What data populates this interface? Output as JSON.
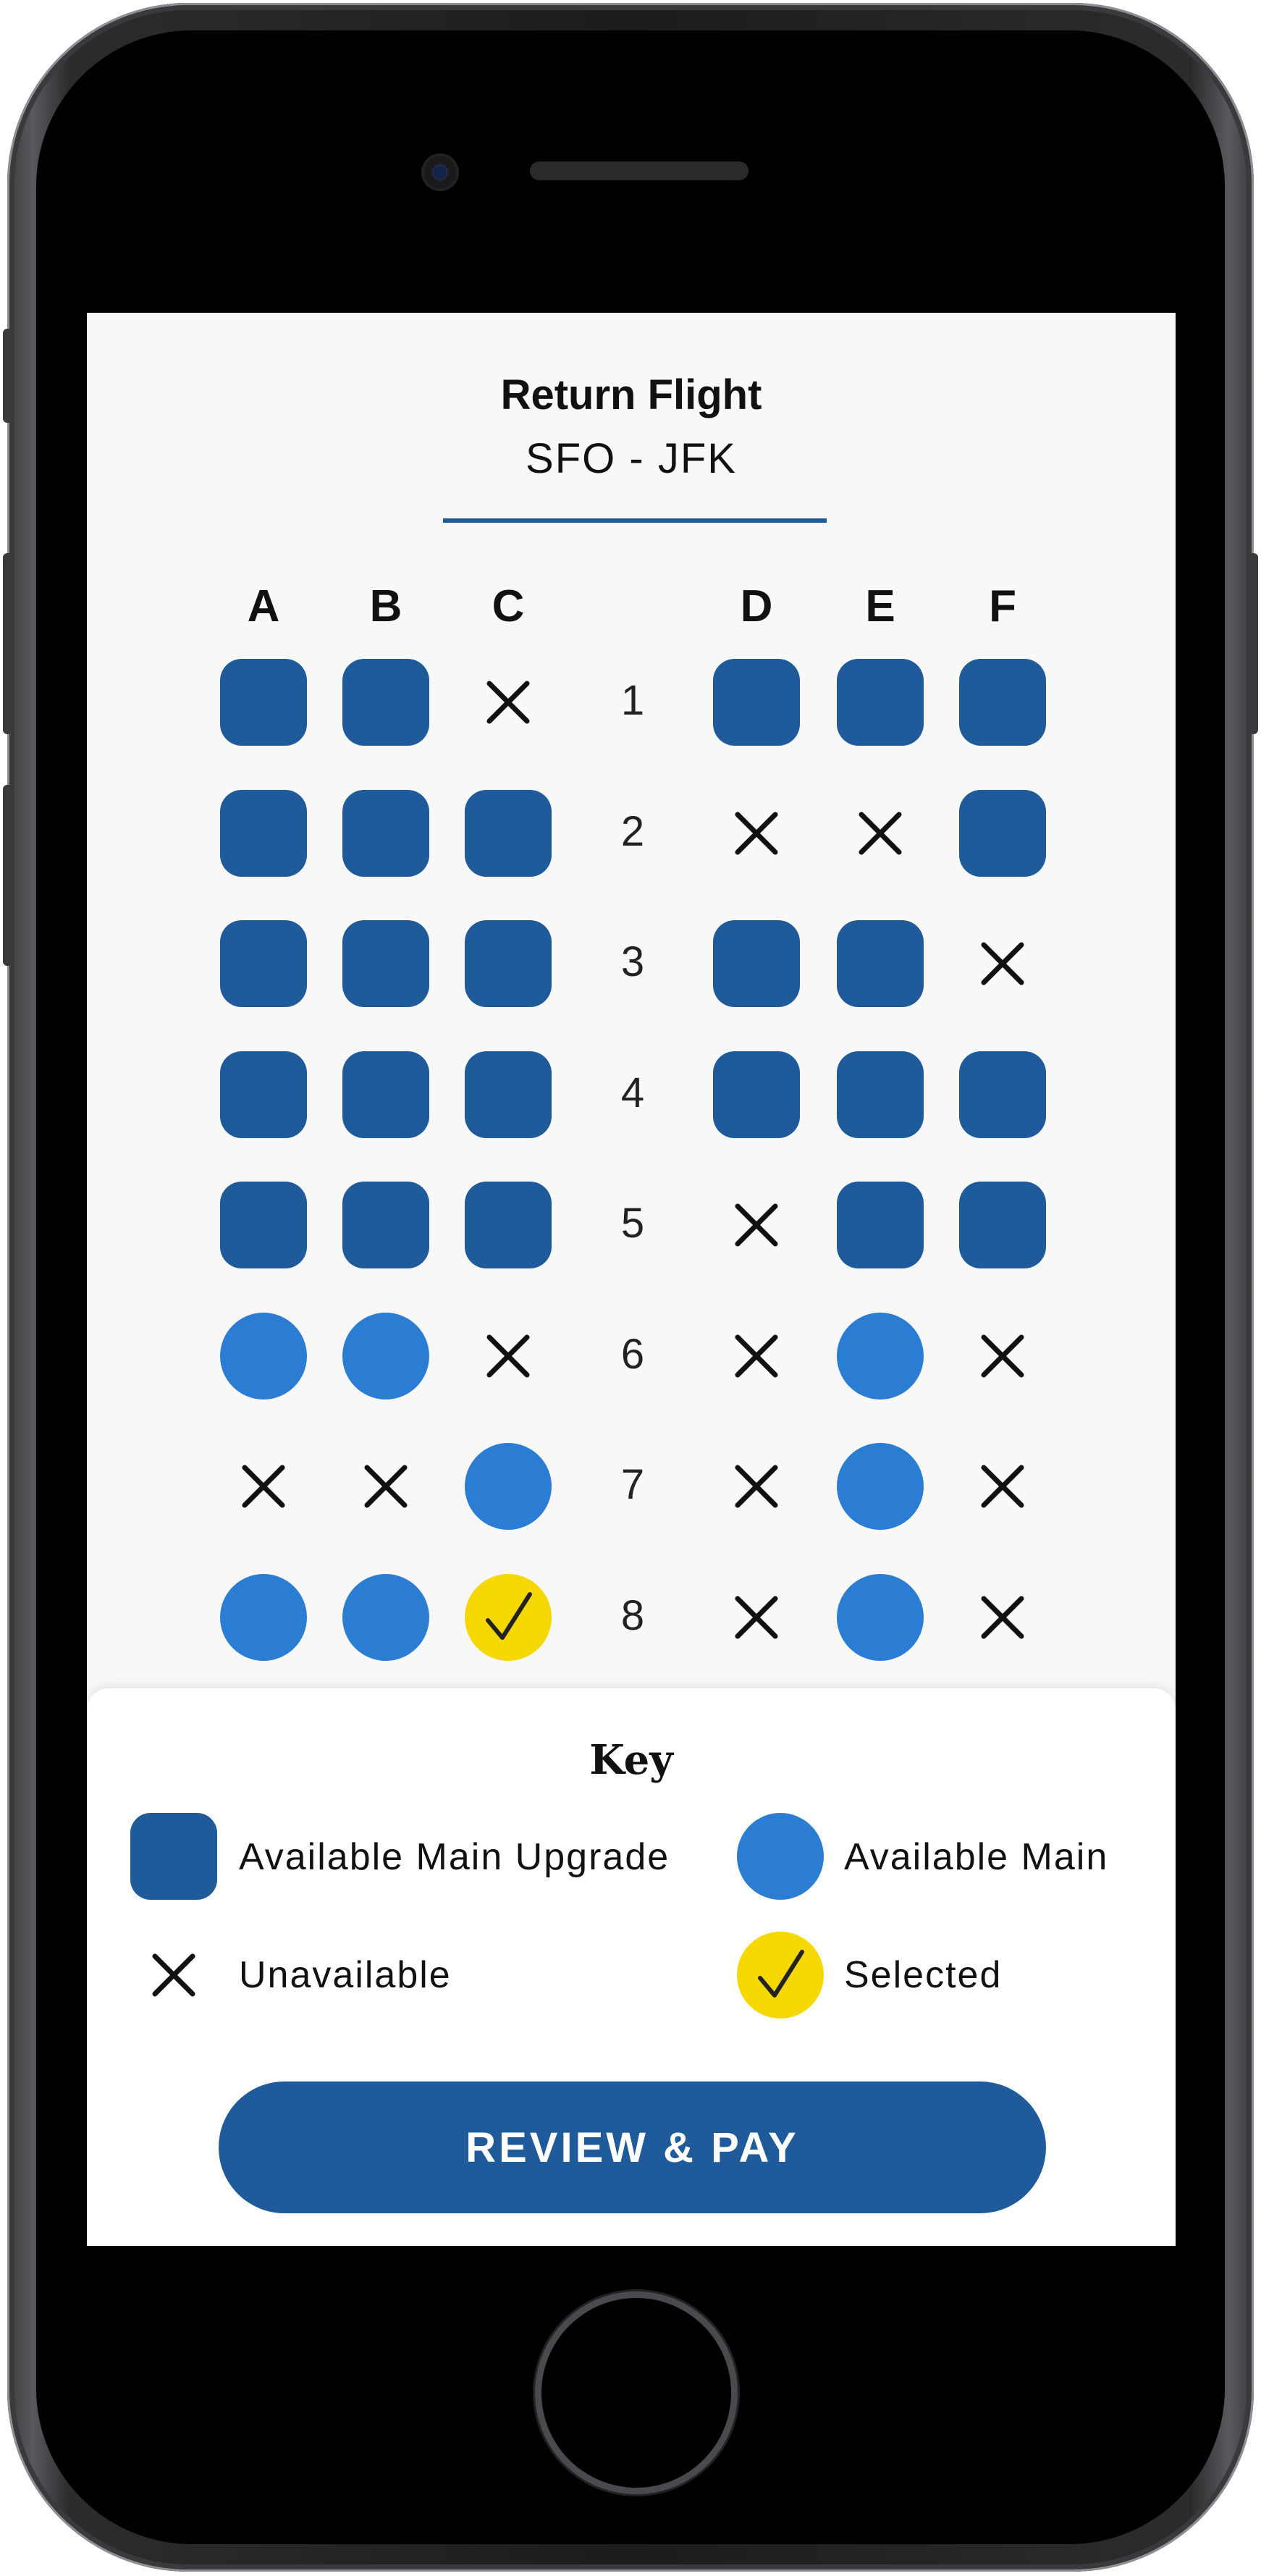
{
  "header": {
    "title": "Return Flight",
    "route": "SFO - JFK"
  },
  "columns_left": [
    "A",
    "B",
    "C"
  ],
  "columns_right": [
    "D",
    "E",
    "F"
  ],
  "rows": [
    {
      "number": "1",
      "seats": [
        "upgrade",
        "upgrade",
        "unavailable",
        "upgrade",
        "upgrade",
        "upgrade"
      ]
    },
    {
      "number": "2",
      "seats": [
        "upgrade",
        "upgrade",
        "upgrade",
        "unavailable",
        "unavailable",
        "upgrade"
      ]
    },
    {
      "number": "3",
      "seats": [
        "upgrade",
        "upgrade",
        "upgrade",
        "upgrade",
        "upgrade",
        "unavailable"
      ]
    },
    {
      "number": "4",
      "seats": [
        "upgrade",
        "upgrade",
        "upgrade",
        "upgrade",
        "upgrade",
        "upgrade"
      ]
    },
    {
      "number": "5",
      "seats": [
        "upgrade",
        "upgrade",
        "upgrade",
        "unavailable",
        "upgrade",
        "upgrade"
      ]
    },
    {
      "number": "6",
      "seats": [
        "main",
        "main",
        "unavailable",
        "unavailable",
        "main",
        "unavailable"
      ]
    },
    {
      "number": "7",
      "seats": [
        "unavailable",
        "unavailable",
        "main",
        "unavailable",
        "main",
        "unavailable"
      ]
    },
    {
      "number": "8",
      "seats": [
        "main",
        "main",
        "selected",
        "unavailable",
        "main",
        "unavailable"
      ]
    }
  ],
  "key": {
    "title": "Key",
    "available_upgrade": "Available Main Upgrade",
    "available_main": "Available Main",
    "unavailable": "Unavailable",
    "selected": "Selected"
  },
  "action": {
    "label": "REVIEW & PAY"
  },
  "colors": {
    "upgrade": "#1f5a9a",
    "main": "#2b7dd4",
    "selected": "#f5d800",
    "button": "#1f5a9a",
    "screen_bg": "#f8f8f8"
  },
  "icons": {
    "unavailable": "x-mark-icon",
    "selected": "checkmark-icon"
  }
}
